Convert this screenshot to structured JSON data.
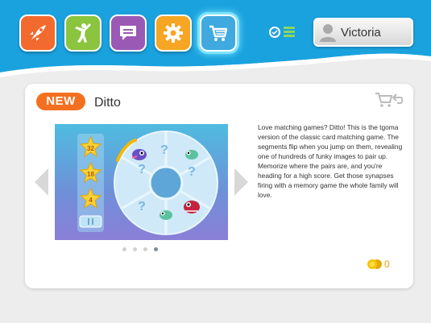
{
  "header": {
    "apps": [
      {
        "name": "rocket",
        "color": "#f26a2e",
        "active": false
      },
      {
        "name": "person-jumping",
        "color": "#8bc43f",
        "active": false
      },
      {
        "name": "chat",
        "color": "#9b59b6",
        "active": false
      },
      {
        "name": "gear",
        "color": "#f6a623",
        "active": false
      },
      {
        "name": "cart",
        "color": "#3fa9e0",
        "active": true
      }
    ],
    "status": {
      "check_icon": "check-circle-icon",
      "list_icon": "list-icon"
    },
    "user": {
      "name": "Victoria",
      "icon": "user-silhouette-icon"
    },
    "colors": {
      "bar": "#1aa2de",
      "bar_light": "#2bb6ec"
    }
  },
  "card": {
    "badge": "NEW",
    "title": "Ditto",
    "description": "Love matching games? Ditto! This is the tgoma version of the classic card matching game. The segments flip when you jump on them, revealing one of hundreds of funky images to pair up. Memorize where the pairs are, and you're heading for a high score. Get those synapses firing with a memory game the whole family will love.",
    "coin_count": "0",
    "screenshot": {
      "star_values": [
        "32",
        "18",
        "4"
      ]
    },
    "carousel": {
      "total": 4,
      "active_index": 3
    }
  }
}
